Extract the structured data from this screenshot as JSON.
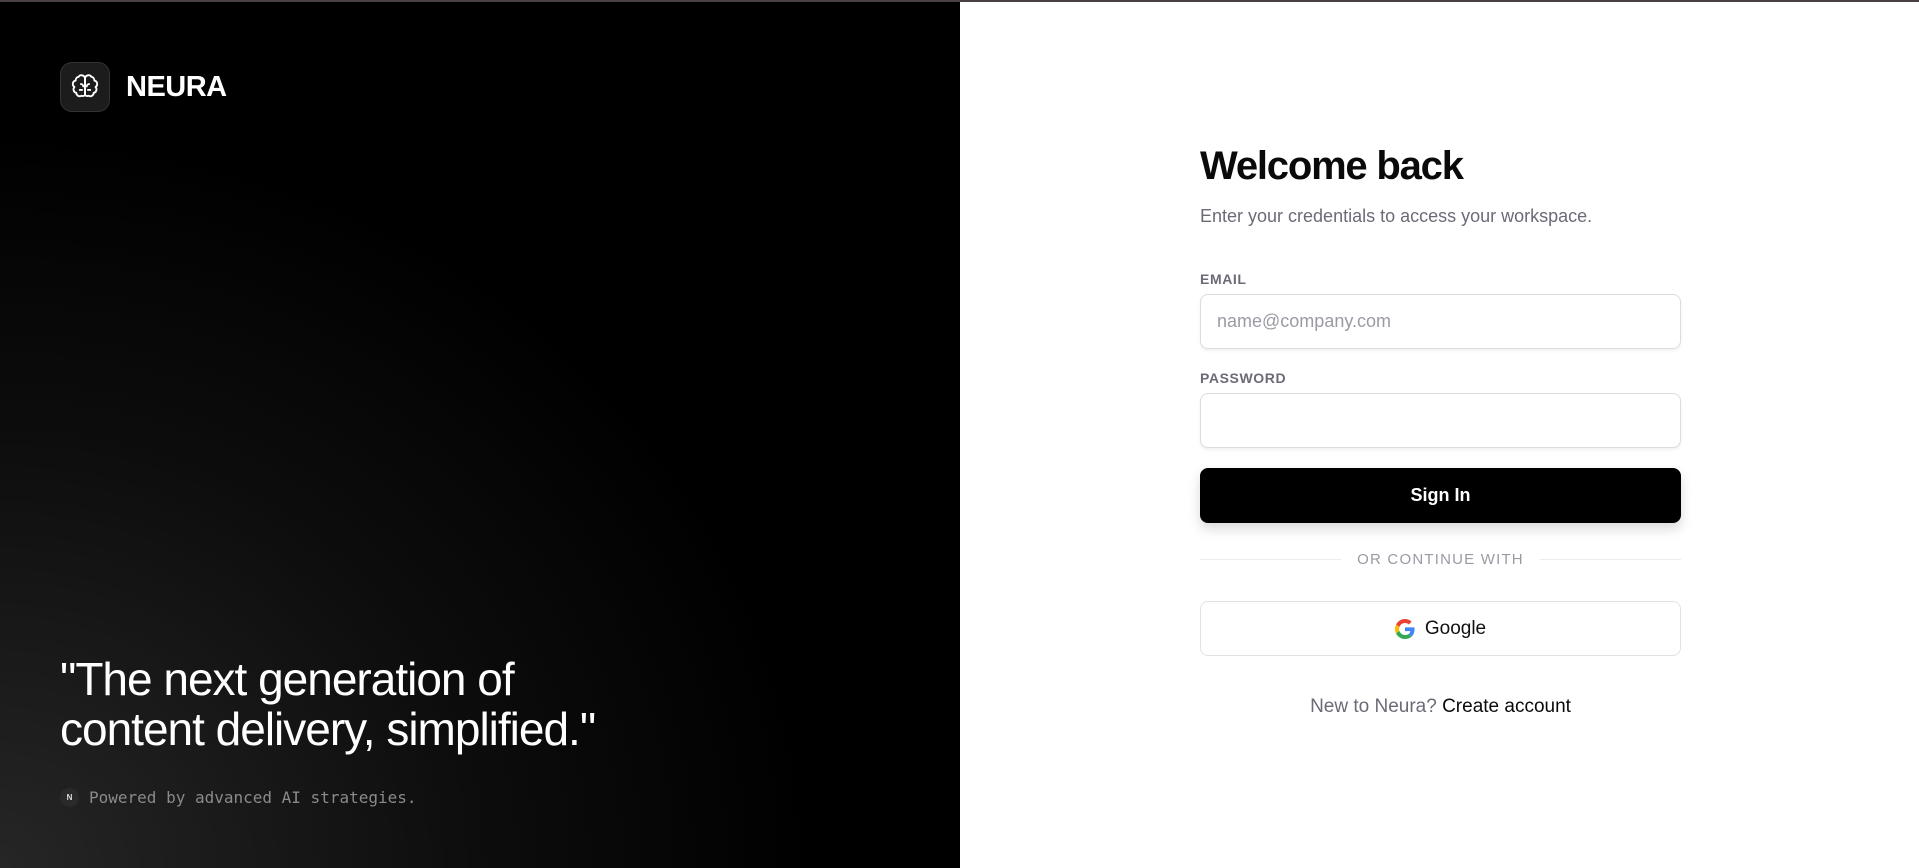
{
  "brand": {
    "name": "NEURA",
    "logo_icon": "brain-icon"
  },
  "hero": {
    "quote_line1": "\"The next generation of",
    "quote_line2": "content delivery, simplified.\"",
    "badge": "N",
    "powered_text": "Powered by advanced AI strategies."
  },
  "login": {
    "title": "Welcome back",
    "subtitle": "Enter your credentials to access your workspace.",
    "email_label": "EMAIL",
    "email_placeholder": "name@company.com",
    "email_value": "",
    "password_label": "PASSWORD",
    "password_value": "",
    "signin_label": "Sign In",
    "divider_text": "OR CONTINUE WITH",
    "google_label": "Google",
    "signup_prompt": "New to Neura?",
    "signup_link": "Create account"
  },
  "colors": {
    "left_bg": "#000000",
    "right_bg": "#ffffff",
    "primary_button": "#000000",
    "muted_text": "#6b6b78"
  }
}
